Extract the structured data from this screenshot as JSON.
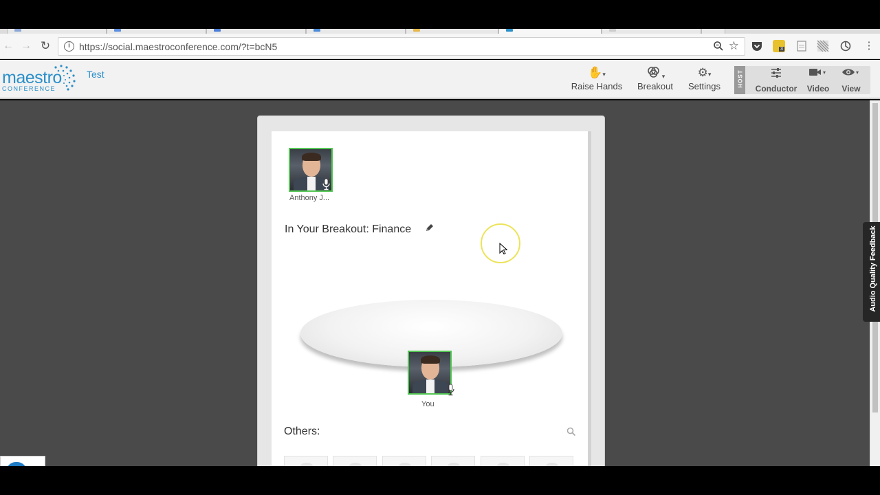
{
  "browser": {
    "url": "https://social.maestroconference.com/?t=bcN5",
    "extension_badge": "3"
  },
  "app": {
    "logo_word": "maestro",
    "logo_sub": "CONFERENCE",
    "conference_name": "Test",
    "toolbar": {
      "raise_hands": "Raise Hands",
      "breakout": "Breakout",
      "settings": "Settings",
      "host_tag": "HOST",
      "conductor": "Conductor",
      "video": "Video",
      "view": "View"
    }
  },
  "panel": {
    "host_participant_name": "Anthony J...",
    "breakout_title": "In Your Breakout: Finance",
    "you_label": "You",
    "others_title": "Others:"
  },
  "feedback_tab": "Audio Quality Feedback",
  "colors": {
    "brand": "#2a8fc9",
    "speaking_border": "#53c653",
    "background": "#4a4a4a",
    "cursor_highlight": "#ece35a"
  }
}
